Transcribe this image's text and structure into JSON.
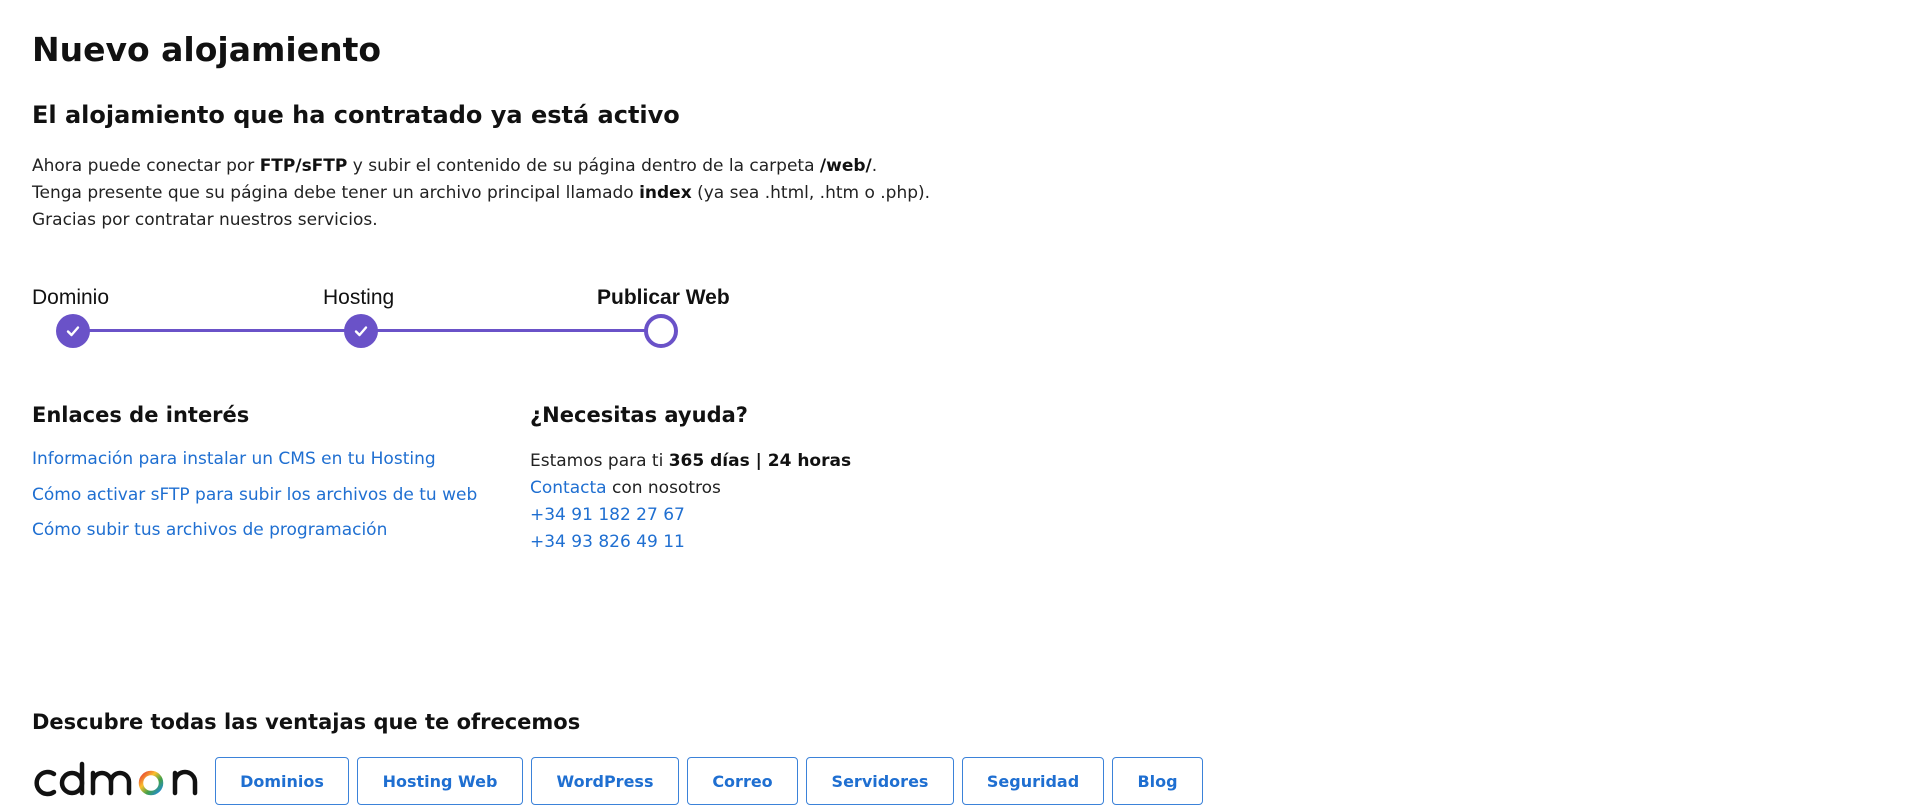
{
  "header": {
    "title": "Nuevo alojamiento",
    "subtitle": "El alojamiento que ha contratado ya está activo"
  },
  "intro": {
    "line1_a": "Ahora puede conectar por ",
    "line1_b": "FTP/sFTP",
    "line1_c": " y subir el contenido de su página dentro de la carpeta ",
    "line1_d": "/web/",
    "line1_e": ".",
    "line2_a": "Tenga presente que su página debe tener un archivo principal llamado ",
    "line2_b": "index",
    "line2_c": " (ya sea .html, .htm o .php).",
    "line3": "Gracias por contratar nuestros servicios."
  },
  "stepper": {
    "steps": [
      {
        "label": "Dominio",
        "state": "done"
      },
      {
        "label": "Hosting",
        "state": "done"
      },
      {
        "label": "Publicar Web",
        "state": "current"
      }
    ],
    "color": "#6a52c8"
  },
  "links": {
    "title": "Enlaces de interés",
    "items": [
      "Información para instalar un CMS en tu Hosting",
      "Cómo activar sFTP para subir los archivos de tu web",
      "Cómo subir tus archivos de programación"
    ],
    "color": "#1f6fd1"
  },
  "help": {
    "title": "¿Necesitas ayuda?",
    "availability_prefix": "Estamos para ti ",
    "availability_bold": "365 días | 24 horas",
    "contact_link": "Contacta",
    "contact_suffix": " con nosotros",
    "phone1": "+34 91 182 27 67",
    "phone2": "+34 93 826 49 11"
  },
  "footer": {
    "title": "Descubre todas las ventajas que te ofrecemos",
    "logo_icon": "cdmon-logo",
    "buttons": [
      "Dominios",
      "Hosting Web",
      "WordPress",
      "Correo",
      "Servidores",
      "Seguridad",
      "Blog"
    ]
  }
}
